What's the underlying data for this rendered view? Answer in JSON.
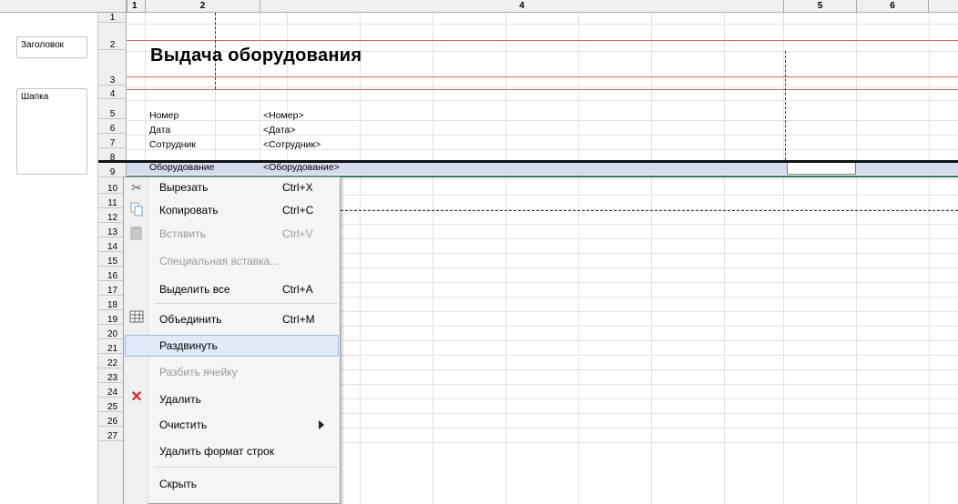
{
  "columns": [
    "1",
    "2",
    "4",
    "5",
    "6"
  ],
  "groups": [
    {
      "label": "Заголовок"
    },
    {
      "label": "Шапка"
    }
  ],
  "rows": [
    "1",
    "2",
    "3",
    "4",
    "5",
    "6",
    "7",
    "8",
    "9",
    "10",
    "11",
    "12",
    "13",
    "14",
    "15",
    "16",
    "17",
    "18",
    "19",
    "20",
    "21",
    "22",
    "23",
    "24",
    "25",
    "26",
    "27"
  ],
  "document": {
    "title": "Выдача оборудования",
    "fields": [
      {
        "label": "Номер",
        "value": "<Номер>"
      },
      {
        "label": "Дата",
        "value": "<Дата>"
      },
      {
        "label": "Сотрудник",
        "value": "<Сотрудник>"
      },
      {
        "label": "Оборудование",
        "value": "<Оборудование>"
      }
    ]
  },
  "context_menu": {
    "items": [
      {
        "label": "Вырезать",
        "shortcut": "Ctrl+X",
        "icon": "scissors-icon",
        "enabled": true
      },
      {
        "label": "Копировать",
        "shortcut": "Ctrl+C",
        "icon": "copy-icon",
        "enabled": true
      },
      {
        "label": "Вставить",
        "shortcut": "Ctrl+V",
        "icon": "paste-icon",
        "enabled": false
      },
      {
        "label": "Специальная вставка...",
        "shortcut": "",
        "icon": "",
        "enabled": false
      },
      {
        "label": "Выделить все",
        "shortcut": "Ctrl+A",
        "icon": "",
        "enabled": true
      },
      {
        "label": "Объединить",
        "shortcut": "Ctrl+M",
        "icon": "merge-cells-icon",
        "enabled": true
      },
      {
        "label": "Раздвинуть",
        "shortcut": "",
        "icon": "",
        "enabled": true,
        "highlighted": true
      },
      {
        "label": "Разбить ячейку",
        "shortcut": "",
        "icon": "",
        "enabled": false
      },
      {
        "label": "Удалить",
        "shortcut": "",
        "icon": "delete-icon",
        "enabled": true
      },
      {
        "label": "Очистить",
        "shortcut": "",
        "icon": "",
        "enabled": true,
        "submenu": true
      },
      {
        "label": "Удалить формат строк",
        "shortcut": "",
        "icon": "",
        "enabled": true
      },
      {
        "label": "Скрыть",
        "shortcut": "",
        "icon": "",
        "enabled": true
      }
    ]
  },
  "colors": {
    "group_line": "#e06060",
    "selection": "#d5dcef",
    "menu_highlight": "#dfe9f8"
  }
}
